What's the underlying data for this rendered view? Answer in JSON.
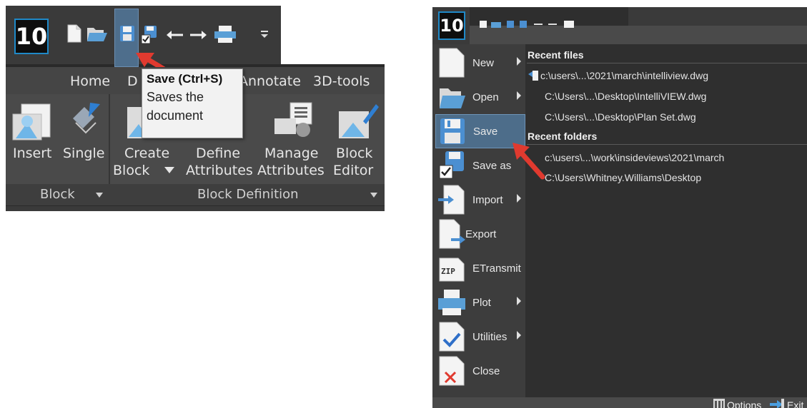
{
  "left_panel": {
    "logo_text": "10",
    "qat_icons": [
      "new-file-icon",
      "open-folder-icon",
      "save-icon",
      "save-all-icon",
      "undo-arrow-icon",
      "redo-arrow-icon",
      "print-icon",
      "customize-icon"
    ],
    "tabs": [
      "Home",
      "D",
      "Annotate",
      "3D-tools"
    ],
    "tooltip": {
      "title": "Save (Ctrl+S)",
      "description_line1": "Saves the",
      "description_line2": "document"
    },
    "ribbon_buttons": [
      {
        "label": "Insert"
      },
      {
        "label": "Single"
      },
      {
        "label_line1": "Create",
        "label_line2": "Block"
      },
      {
        "label_line1": "Define",
        "label_line2": "Attributes"
      },
      {
        "label_line1": "Manage",
        "label_line2": "Attributes"
      },
      {
        "label_line1": "Block",
        "label_line2": "Editor"
      }
    ],
    "groups": {
      "block": "Block",
      "block_definition": "Block Definition"
    }
  },
  "right_panel": {
    "logo_text": "10",
    "menu_items": [
      {
        "label": "New",
        "has_submenu": true
      },
      {
        "label": "Open",
        "has_submenu": true
      },
      {
        "label": "Save",
        "has_submenu": false,
        "active": true
      },
      {
        "label": "Save as",
        "has_submenu": false
      },
      {
        "label": "Import",
        "has_submenu": true
      },
      {
        "label": "Export",
        "has_submenu": false
      },
      {
        "label": "ETransmit",
        "has_submenu": false
      },
      {
        "label": "Plot",
        "has_submenu": true
      },
      {
        "label": "Utilities",
        "has_submenu": true
      },
      {
        "label": "Close",
        "has_submenu": false
      }
    ],
    "zip_icon_text": "ZIP",
    "recent_files_header": "Recent files",
    "recent_files": [
      "c:\\users\\...\\2021\\march\\intelliview.dwg",
      "C:\\Users\\...\\Desktop\\IntelliVIEW.dwg",
      "C:\\Users\\...\\Desktop\\Plan Set.dwg"
    ],
    "recent_folders_header": "Recent folders",
    "recent_folders": [
      "c:\\users\\...\\work\\insideviews\\2021\\march",
      "C:\\Users\\Whitney.Williams\\Desktop"
    ],
    "status_bar": {
      "options_label": "Options",
      "exit_label": "Exit"
    }
  },
  "colors": {
    "highlight_blue": "#4d6d8a",
    "arrow_red": "#e03a2f",
    "dark_bg": "#2b2b2b"
  }
}
